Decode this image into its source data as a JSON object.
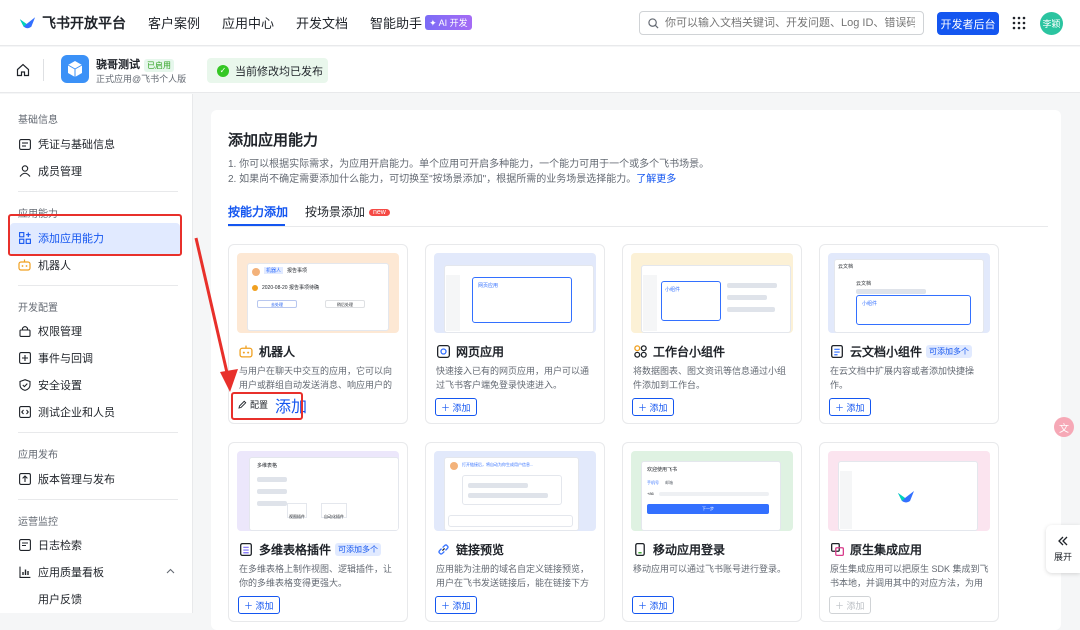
{
  "topnav": {
    "brand": "飞书开放平台",
    "items": [
      "客户案例",
      "应用中心",
      "开发文档",
      "智能助手"
    ],
    "ai_badge": "✦ AI 开发",
    "search_placeholder": "你可以输入文档关键词、开发问题、Log ID、错误码",
    "dev_console": "开发者后台",
    "avatar_text": "李颖"
  },
  "app": {
    "name": "骁哥测试",
    "status": "已启用",
    "subtitle": "正式应用@飞书个人版",
    "publish_status": "当前修改均已发布"
  },
  "sidebar": {
    "sections": [
      {
        "title": "基础信息",
        "items": [
          "凭证与基础信息",
          "成员管理"
        ]
      },
      {
        "title": "应用能力",
        "items": [
          "添加应用能力",
          "机器人"
        ]
      },
      {
        "title": "开发配置",
        "items": [
          "权限管理",
          "事件与回调",
          "安全设置",
          "测试企业和人员"
        ]
      },
      {
        "title": "应用发布",
        "items": [
          "版本管理与发布"
        ]
      },
      {
        "title": "运营监控",
        "items": [
          "日志检索",
          "应用质量看板",
          "用户反馈"
        ]
      }
    ]
  },
  "main": {
    "title": "添加应用能力",
    "desc1": "1. 你可以根据实际需求，为应用开启能力。单个应用可开启多种能力，一个能力可用于一个或多个飞书场景。",
    "desc2": "2. 如果尚不确定需要添加什么能力，可切换至\"按场景添加\"，根据所需的业务场景选择能力。",
    "learn_more": "了解更多",
    "tabs": [
      "按能力添加",
      "按场景添加"
    ],
    "new_badge": "new",
    "multi_badge": "可添加多个",
    "add_label": "＋ 添加",
    "config_label": "配置",
    "big_add": "添加",
    "cards": [
      {
        "title": "机器人",
        "desc": "与用户在聊天中交互的应用，它可以向用户或群组自动发送消息、响应用户的消..."
      },
      {
        "title": "网页应用",
        "desc": "快速接入已有的网页应用，用户可以通过飞书客户端免登录快速进入。"
      },
      {
        "title": "工作台小组件",
        "desc": "将数据图表、图文资讯等信息通过小组件添加到工作台。"
      },
      {
        "title": "云文档小组件",
        "desc": "在云文档中扩展内容或者添加快捷操作。"
      },
      {
        "title": "多维表格插件",
        "desc": "在多维表格上制作视图、逻辑插件，让你的多维表格变得更强大。"
      },
      {
        "title": "链接预览",
        "desc": "应用能为注册的域名自定义链接预览，用户在飞书发送链接后，能在链接下方展示..."
      },
      {
        "title": "移动应用登录",
        "desc": "移动应用可以通过飞书账号进行登录。"
      },
      {
        "title": "原生集成应用",
        "desc": "原生集成应用可以把原生 SDK 集成到飞书本地，并调用其中的对应方法，为用户提..."
      }
    ],
    "preview_texts": {
      "robot_name": "机器人",
      "robot_tag": "报告事项",
      "robot_line": "2020-08-20 报告事项待确",
      "robot_btn1": "去处理",
      "robot_btn2": "稍后处理",
      "web_label": "网页应用",
      "widget_label": "小组件",
      "doc_title": "云文档",
      "doc_body": "云文档",
      "doc_widget": "小组件",
      "bitable_title": "多维表格",
      "bitable_btn1": "视图插件",
      "bitable_btn2": "自动化插件",
      "link_msg": "打开链接后，将自动为你生成用户信息...",
      "login_title": "欢迎使用飞书",
      "login_tab1": "手机号",
      "login_tab2": "邮箱",
      "login_prefix": "+86",
      "login_btn": "下一步"
    }
  },
  "side_panel": {
    "label": "展开"
  }
}
